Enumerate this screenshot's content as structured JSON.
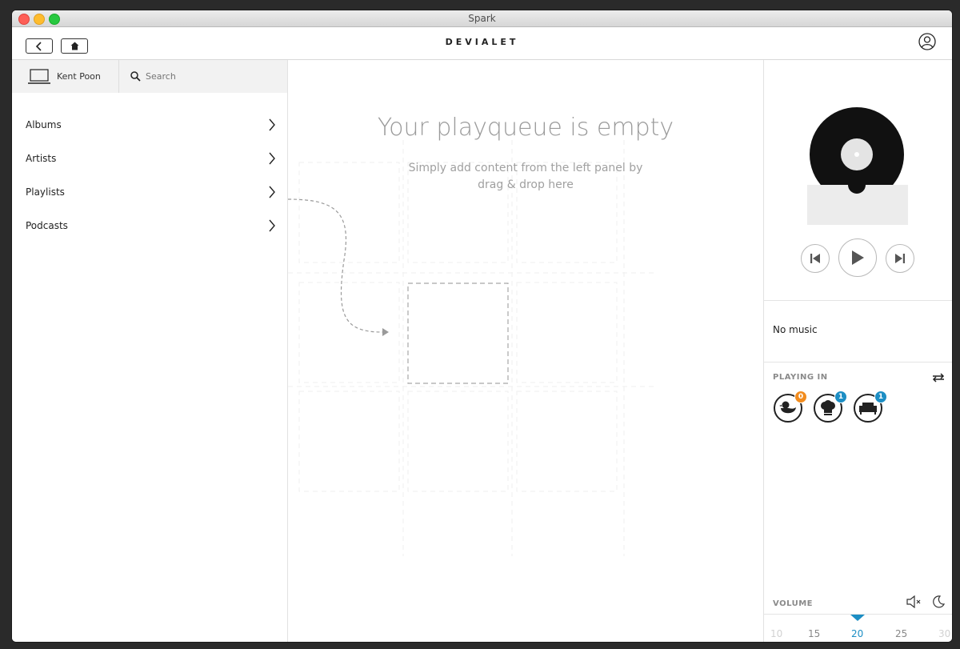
{
  "window": {
    "title": "Spark"
  },
  "header": {
    "brand": "DEVIALET"
  },
  "left_panel": {
    "device_name": "Kent Poon",
    "search_placeholder": "Search",
    "menu": [
      {
        "label": "Albums"
      },
      {
        "label": "Artists"
      },
      {
        "label": "Playlists"
      },
      {
        "label": "Podcasts"
      }
    ]
  },
  "queue": {
    "title": "Your playqueue is empty",
    "subtitle_line1": "Simply add content from the left panel by",
    "subtitle_line2": "drag & drop here"
  },
  "player": {
    "now_playing": "No music",
    "playing_in_label": "PLAYING IN",
    "speakers": [
      {
        "icon": "duck-icon",
        "badge": "0",
        "badge_color": "#f28c1e"
      },
      {
        "icon": "chef-hat-icon",
        "badge": "1",
        "badge_color": "#1c8ec4"
      },
      {
        "icon": "sofa-icon",
        "badge": "1",
        "badge_color": "#1c8ec4"
      }
    ],
    "volume_label": "VOLUME",
    "volume_ticks": [
      "10",
      "15",
      "20",
      "25",
      "30"
    ],
    "volume_current": "20",
    "accent_color": "#1c8ec4"
  }
}
